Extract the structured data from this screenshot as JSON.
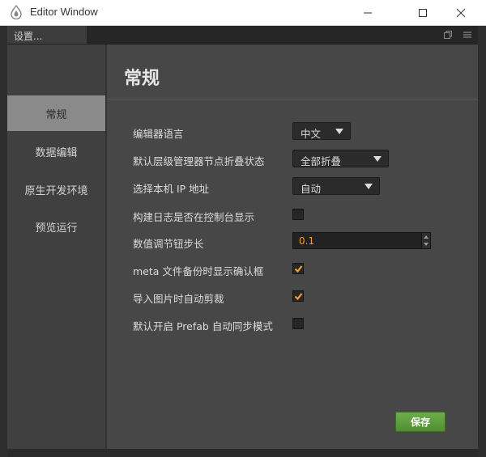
{
  "window": {
    "title": "Editor Window",
    "controls": [
      "minimize-icon",
      "maximize-icon",
      "close-icon"
    ]
  },
  "tab": {
    "label": "设置...",
    "tools": [
      "popout-icon",
      "menu-icon"
    ]
  },
  "sidebar": {
    "items": [
      {
        "label": "常规",
        "active": true
      },
      {
        "label": "数据编辑",
        "active": false
      },
      {
        "label": "原生开发环境",
        "active": false
      },
      {
        "label": "预览运行",
        "active": false
      }
    ]
  },
  "main": {
    "title": "常规",
    "settings": {
      "language": {
        "label": "编辑器语言",
        "value": "中文"
      },
      "fold_state": {
        "label": "默认层级管理器节点折叠状态",
        "value": "全部折叠"
      },
      "ip": {
        "label": "选择本机 IP 地址",
        "value": "自动"
      },
      "build_log": {
        "label": "构建日志是否在控制台显示",
        "checked": false
      },
      "step": {
        "label": "数值调节钮步长",
        "value": "0.1"
      },
      "meta_backup": {
        "label": "meta 文件备份时显示确认框",
        "checked": true
      },
      "auto_trim": {
        "label": "导入图片时自动剪裁",
        "checked": true
      },
      "prefab_sync": {
        "label": "默认开启 Prefab 自动同步模式",
        "checked": false
      }
    },
    "save_label": "保存"
  },
  "colors": {
    "accent_check": "#f0a030",
    "save_green": "#5b9e3c",
    "active_nav": "#8a8a8a"
  }
}
